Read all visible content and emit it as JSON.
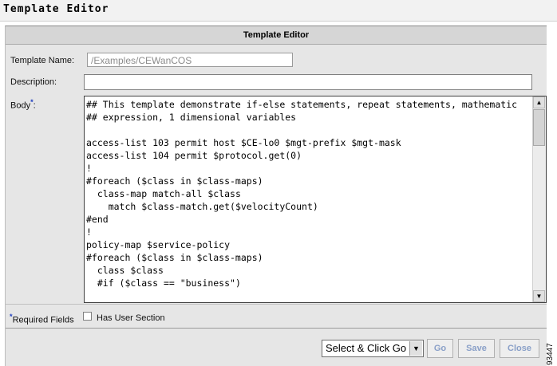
{
  "window": {
    "title": "Template Editor"
  },
  "panel": {
    "header": "Template Editor"
  },
  "form": {
    "template_name_label": "Template Name:",
    "template_name_value": "/Examples/CEWanCOS",
    "description_label": "Description:",
    "description_value": "",
    "body_label": "Body",
    "required_marker": "*",
    "body_text": "## This template demonstrate if-else statements, repeat statements, mathematic\n## expression, 1 dimensional variables\n\naccess-list 103 permit host $CE-lo0 $mgt-prefix $mgt-mask\naccess-list 104 permit $protocol.get(0)\n!\n#foreach ($class in $class-maps)\n  class-map match-all $class\n    match $class-match.get($velocityCount)\n#end\n!\npolicy-map $service-policy\n#foreach ($class in $class-maps)\n  class $class\n  #if ($class == \"business\")"
  },
  "footer": {
    "required_fields_label": "Required Fields",
    "has_user_section_label": "Has User Section",
    "has_user_section_checked": false
  },
  "actions": {
    "select_value": "Select & Click Go",
    "go_label": "Go",
    "save_label": "Save",
    "close_label": "Close"
  },
  "figure_number": "93447",
  "colors": {
    "disabled_button_text": "#8aa0c8",
    "required_marker": "#1f3fbf"
  }
}
